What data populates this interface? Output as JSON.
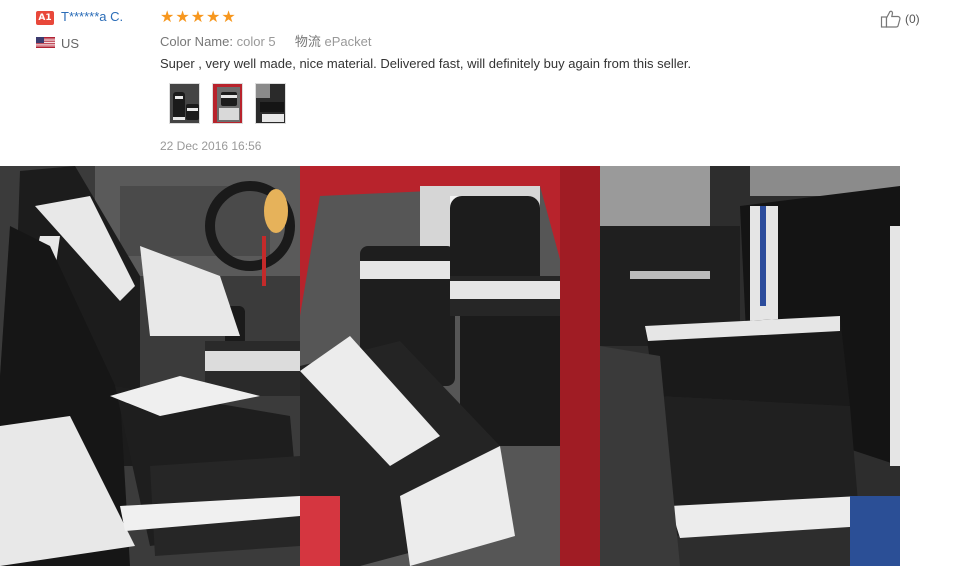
{
  "review": {
    "badge": "A1",
    "username": "T******a C.",
    "country": "US",
    "rating": 5,
    "color_label": "Color Name:",
    "color_value": "color 5",
    "shipping_label": "物流",
    "shipping_value": "ePacket",
    "text": "Super , very well made, nice material. Delivered fast, will definitely buy again from this seller.",
    "date": "22 Dec 2016 16:56",
    "helpful_count": "(0)"
  },
  "thumbnails": [
    {
      "label": "thumbnail-1"
    },
    {
      "label": "thumbnail-2"
    },
    {
      "label": "thumbnail-3"
    }
  ],
  "colors": {
    "star": "#f7971e",
    "username": "#2a6cb7",
    "badge": "#e8483a",
    "seat_black": "#1c1c1c",
    "seat_white": "#ebebeb",
    "car_red": "#b8232c"
  }
}
